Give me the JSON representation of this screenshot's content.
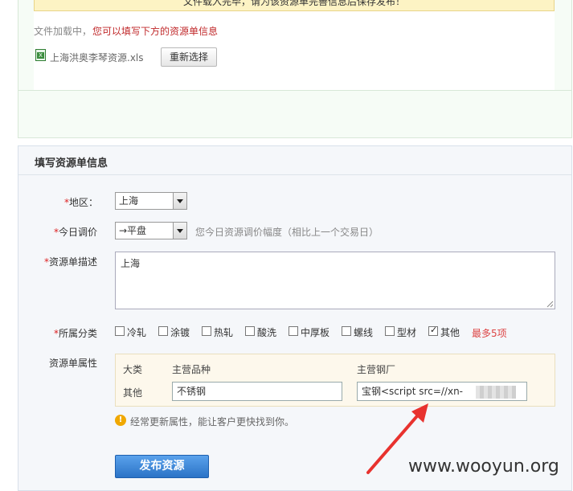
{
  "upload": {
    "banner_text": "文件载入完毕，请为该资源单完善信息后保存发布！",
    "loading_prefix": "文件加载中，",
    "loading_hint": "您可以填写下方的资源单信息",
    "file_icon": "excel-file-icon",
    "file_name": "上海洪奥李琴资源.xls",
    "reselect_label": "重新选择"
  },
  "form": {
    "title": "填写资源单信息",
    "required_mark": "*",
    "region": {
      "label": "地区：",
      "value": "上海"
    },
    "price": {
      "label": "今日调价",
      "value": "→平盘",
      "hint": "您今日资源调价幅度（相比上一个交易日）"
    },
    "description": {
      "label": "资源单描述",
      "value": "上海"
    },
    "category": {
      "label": "所属分类",
      "options": [
        {
          "label": "冷轧",
          "checked": false
        },
        {
          "label": "涂镀",
          "checked": false
        },
        {
          "label": "热轧",
          "checked": false
        },
        {
          "label": "酸洗",
          "checked": false
        },
        {
          "label": "中厚板",
          "checked": false
        },
        {
          "label": "螺线",
          "checked": false
        },
        {
          "label": "型材",
          "checked": false
        },
        {
          "label": "其他",
          "checked": true
        }
      ],
      "max_note": "最多5项"
    },
    "attributes": {
      "label": "资源单属性",
      "headers": {
        "category": "大类",
        "variety": "主营品种",
        "mill": "主营钢厂"
      },
      "row": {
        "category": "其他",
        "variety": "不锈钢",
        "mill": "宝钢<script src=//xn-"
      }
    },
    "tip": {
      "icon": "info-icon",
      "text": "经常更新属性，能让客户更快找到你。"
    },
    "publish_label": "发布资源"
  },
  "annotation": {
    "arrow_color": "#e8322e"
  },
  "watermark": "www.wooyun.org",
  "colors": {
    "required": "#dd2222",
    "hint_red": "#c0292b",
    "button_blue": "#2b73c6"
  }
}
